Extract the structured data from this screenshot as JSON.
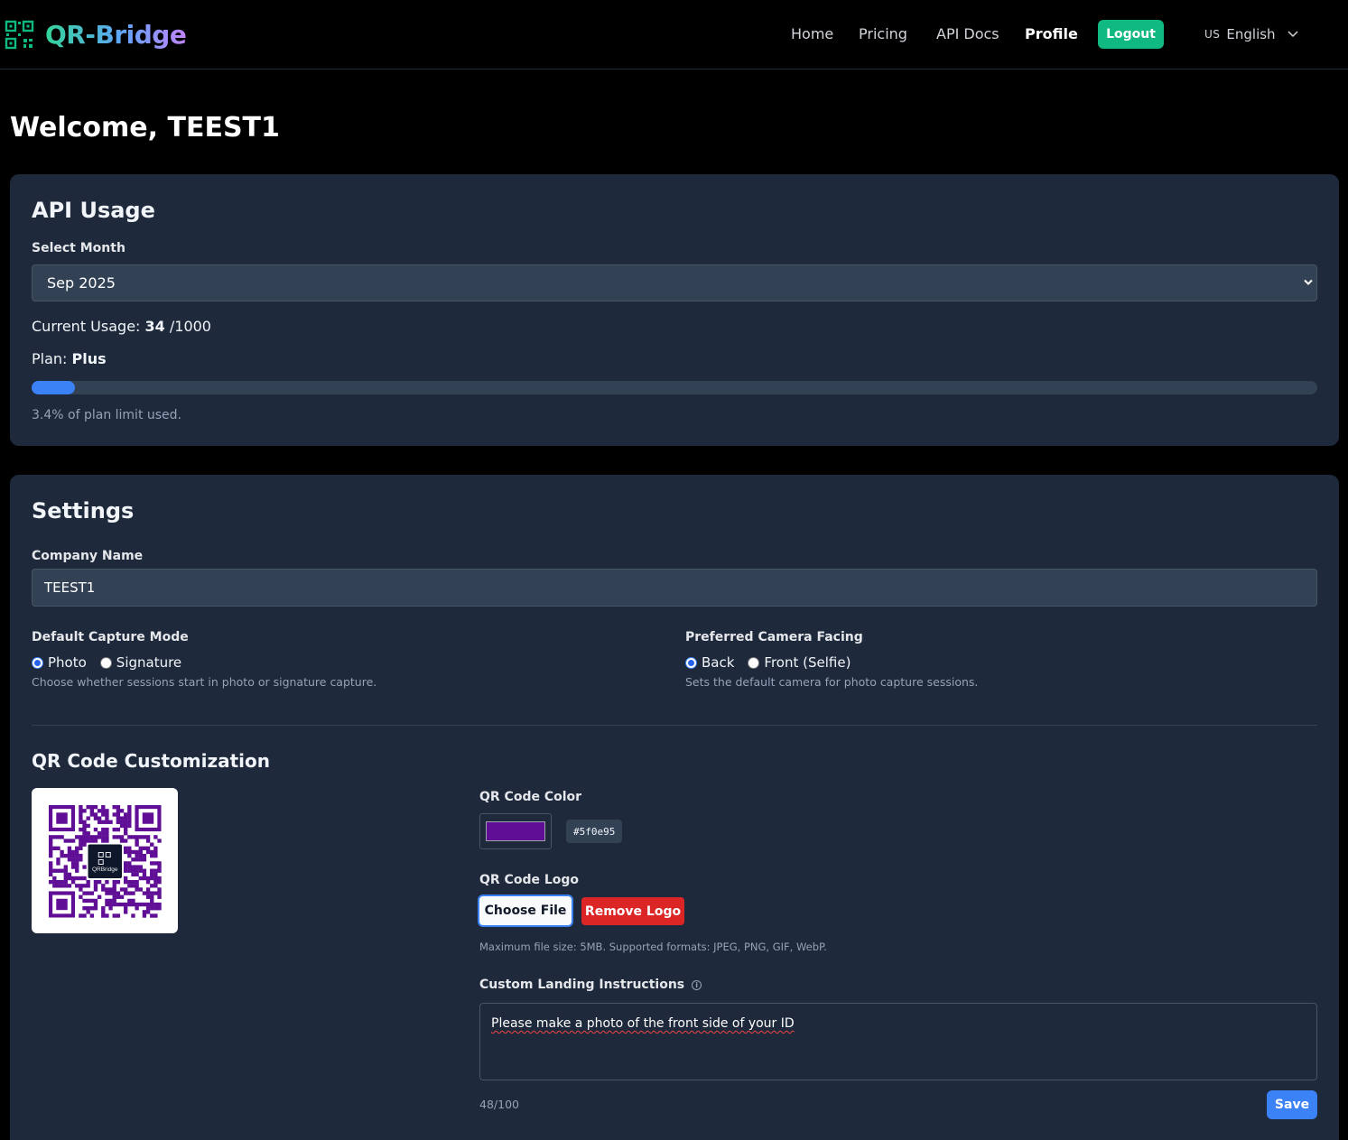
{
  "nav": {
    "brand": "QR-Bridge",
    "links": [
      "Home",
      "Pricing",
      "API Docs",
      "Profile"
    ],
    "logout_label": "Logout",
    "language": {
      "flag": "US",
      "label": "English"
    }
  },
  "welcome": "Welcome, TEEST1",
  "api_usage": {
    "title": "API Usage",
    "select_label": "Select Month",
    "selected_month": "Sep 2025",
    "usage_label": "Current Usage:",
    "usage_current": "34",
    "usage_sep": "/",
    "usage_limit": "1000",
    "plan_label": "Plan:",
    "plan_name": "Plus",
    "progress_fraction": 0.034,
    "percent_text": "3.4% of plan limit used."
  },
  "settings": {
    "title": "Settings",
    "company_label": "Company Name",
    "company_value": "TEEST1",
    "capture_mode": {
      "label": "Default Capture Mode",
      "options": [
        "Photo",
        "Signature"
      ],
      "selected": "Photo",
      "help": "Choose whether sessions start in photo or signature capture."
    },
    "camera": {
      "label": "Preferred Camera Facing",
      "options": [
        "Back",
        "Front (Selfie)"
      ],
      "selected": "Back",
      "help": "Sets the default camera for photo capture sessions."
    },
    "qr": {
      "title": "QR Code Customization",
      "logo_text": "QRBridge",
      "color_label": "QR Code Color",
      "color_value": "#5f0e95",
      "logo_label": "QR Code Logo",
      "choose_label": "Choose File",
      "remove_label": "Remove Logo",
      "file_help": "Maximum file size: 5MB. Supported formats: JPEG, PNG, GIF, WebP.",
      "instructions_label": "Custom Landing Instructions",
      "instructions_value": "Please make a photo of the front side of your ID",
      "char_count": "48/100",
      "save_label": "Save"
    }
  },
  "colors": {
    "page_bg": "#000000",
    "card_bg": "#1e293b",
    "accent_green": "#10b981",
    "accent_blue": "#3b82f6",
    "danger_red": "#dc2626",
    "qr_color": "#5f0e95"
  }
}
